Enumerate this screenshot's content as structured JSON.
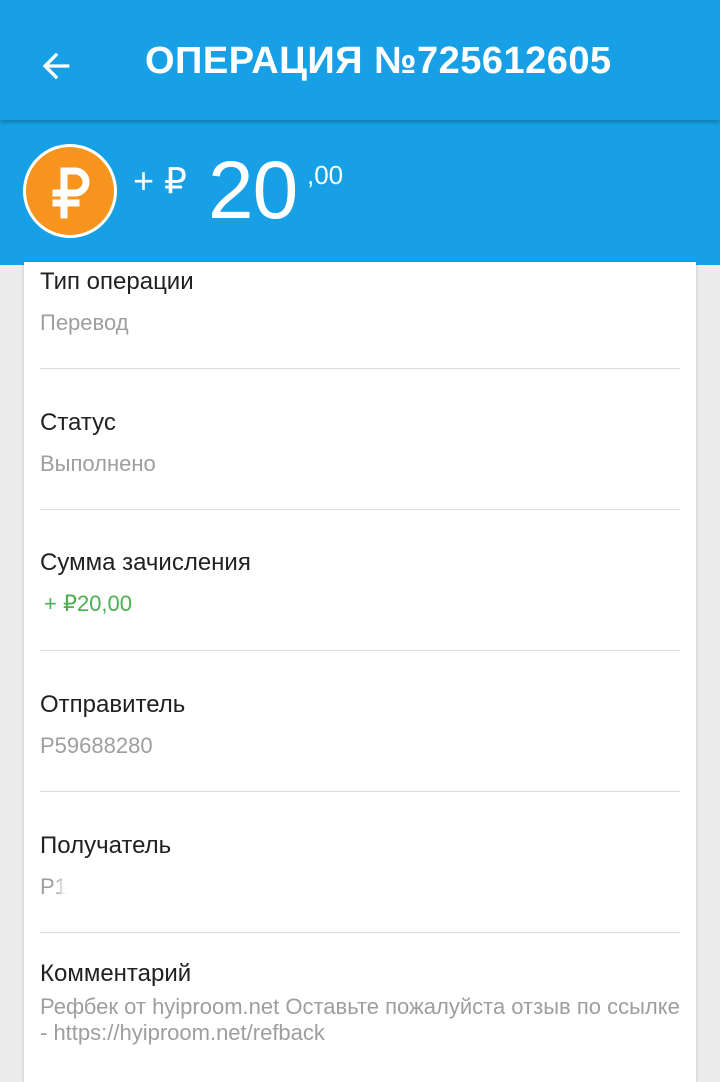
{
  "appbar": {
    "back_icon": "arrow-back-icon",
    "title": "ОПЕРАЦИЯ №725612605"
  },
  "header": {
    "currency_icon": "ruble-coin-icon",
    "sign": "+ ₽",
    "amount_integer": "20",
    "amount_decimals": ",00",
    "coin_color": "#f7941d",
    "background_color": "#17a0e6"
  },
  "details": {
    "type_label": "Тип операции",
    "type_value": "Перевод",
    "status_label": "Статус",
    "status_value": "Выполнено",
    "credit_label": "Сумма зачисления",
    "credit_value": "+ ₽20,00",
    "credit_color": "#4caf50",
    "sender_label": "Отправитель",
    "sender_value": "P59688280",
    "recipient_label": "Получатель",
    "recipient_value": "P1",
    "comment_label": "Комментарий",
    "comment_value": "Рефбек от hyiproom.net  Оставьте пожалуйста отзыв по ссылке - https://hyiproom.net/refback"
  }
}
